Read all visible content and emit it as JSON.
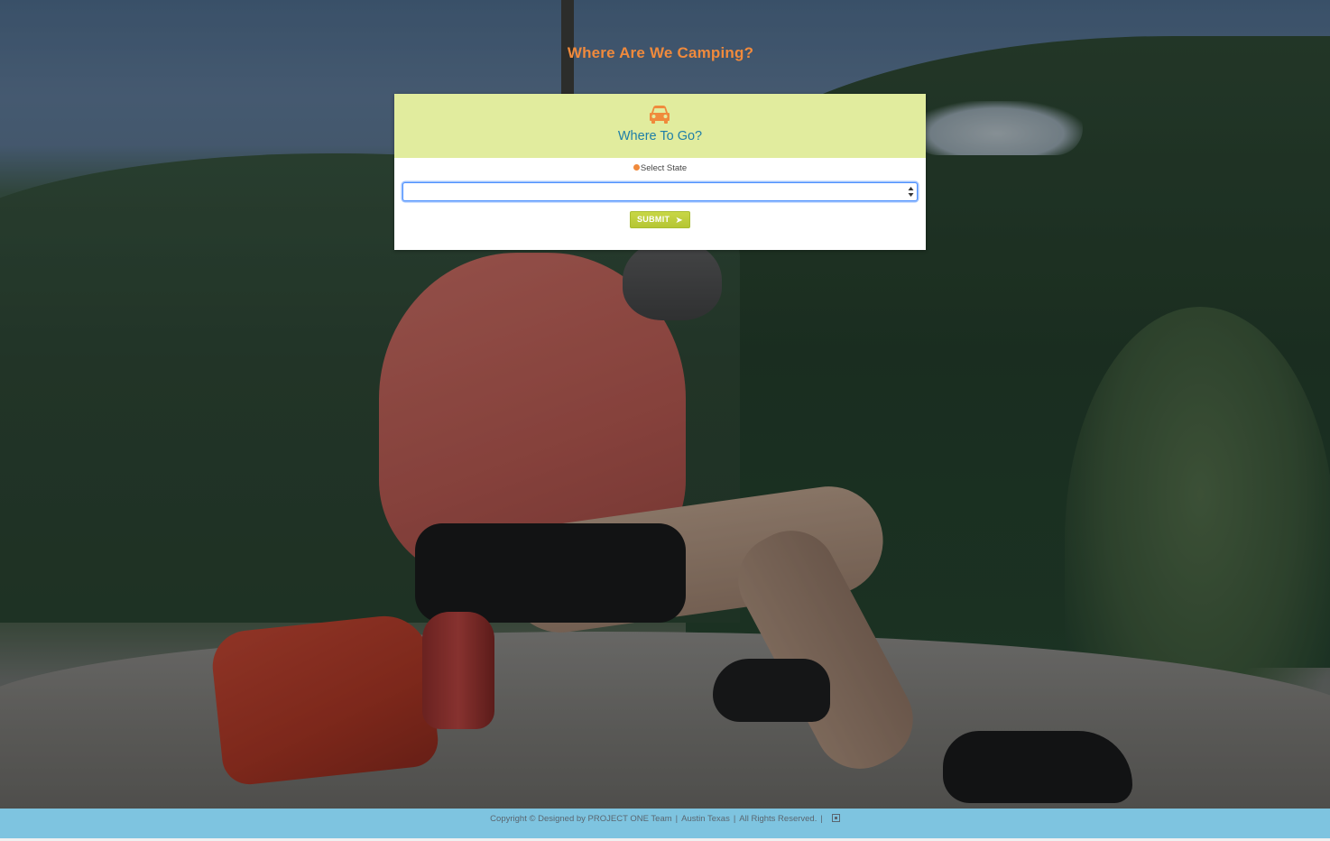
{
  "page": {
    "title": "Where Are We Camping?"
  },
  "card": {
    "icon": "car-icon",
    "heading": "Where To Go?",
    "field_label": "Select State",
    "select": {
      "value": ""
    },
    "submit_label": "SUBMIT",
    "submit_icon": "send-arrow-icon"
  },
  "footer": {
    "copyright": "Copyright © Designed by PROJECT ONE Team",
    "location": "Austin Texas",
    "rights": "All Rights Reserved.",
    "icon": "box-icon"
  },
  "colors": {
    "title": "#f08a3c",
    "card_header_bg": "#e1ec9e",
    "heading": "#1f7fa8",
    "submit_bg": "#b5c634",
    "footer_bg": "#7ec4e0"
  }
}
